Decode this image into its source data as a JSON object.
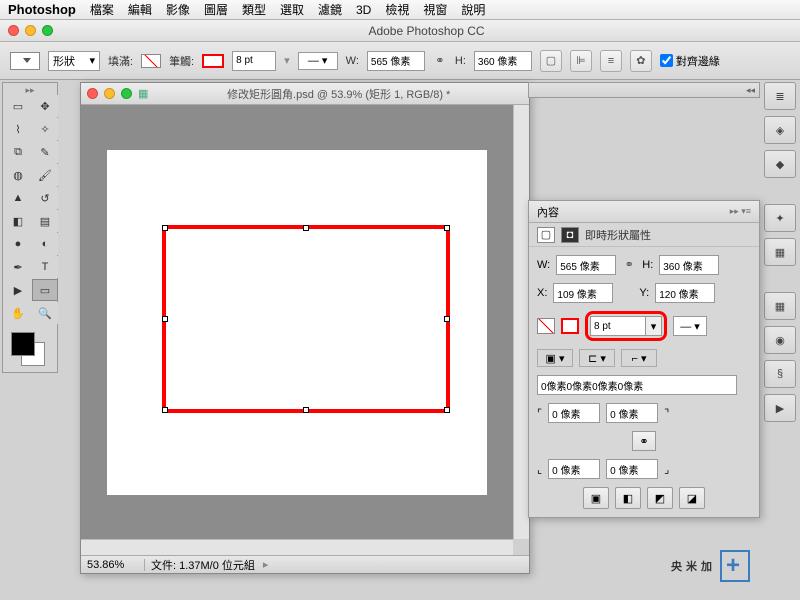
{
  "menubar": {
    "brand": "Photoshop",
    "items": [
      "檔案",
      "編輯",
      "影像",
      "圖層",
      "類型",
      "選取",
      "濾鏡",
      "3D",
      "檢視",
      "視窗",
      "說明"
    ]
  },
  "app_title": "Adobe Photoshop CC",
  "options": {
    "shape_label": "形狀",
    "fill_label": "填滿:",
    "stroke_label": "筆觸:",
    "stroke_size": "8 pt",
    "w_label": "W:",
    "w_value": "565 像素",
    "h_label": "H:",
    "h_value": "360 像素",
    "align_label": "對齊邊緣"
  },
  "document": {
    "title": "修改矩形圓角.psd @ 53.9% (矩形 1, RGB/8) *",
    "zoom": "53.86%",
    "status": "文件: 1.37M/0 位元組"
  },
  "properties": {
    "tab": "內容",
    "subtitle": "即時形狀屬性",
    "w_label": "W:",
    "w_value": "565 像素",
    "h_label": "H:",
    "h_value": "360 像素",
    "x_label": "X:",
    "x_value": "109 像素",
    "y_label": "Y:",
    "y_value": "120 像素",
    "stroke_size": "8 pt",
    "corners_combined": "0像素0像素0像素0像素",
    "corner_value": "0 像素",
    "menu_icon": "▸▸ ▾≡"
  },
  "watermark": {
    "text": "央米加",
    "plus": "+"
  }
}
